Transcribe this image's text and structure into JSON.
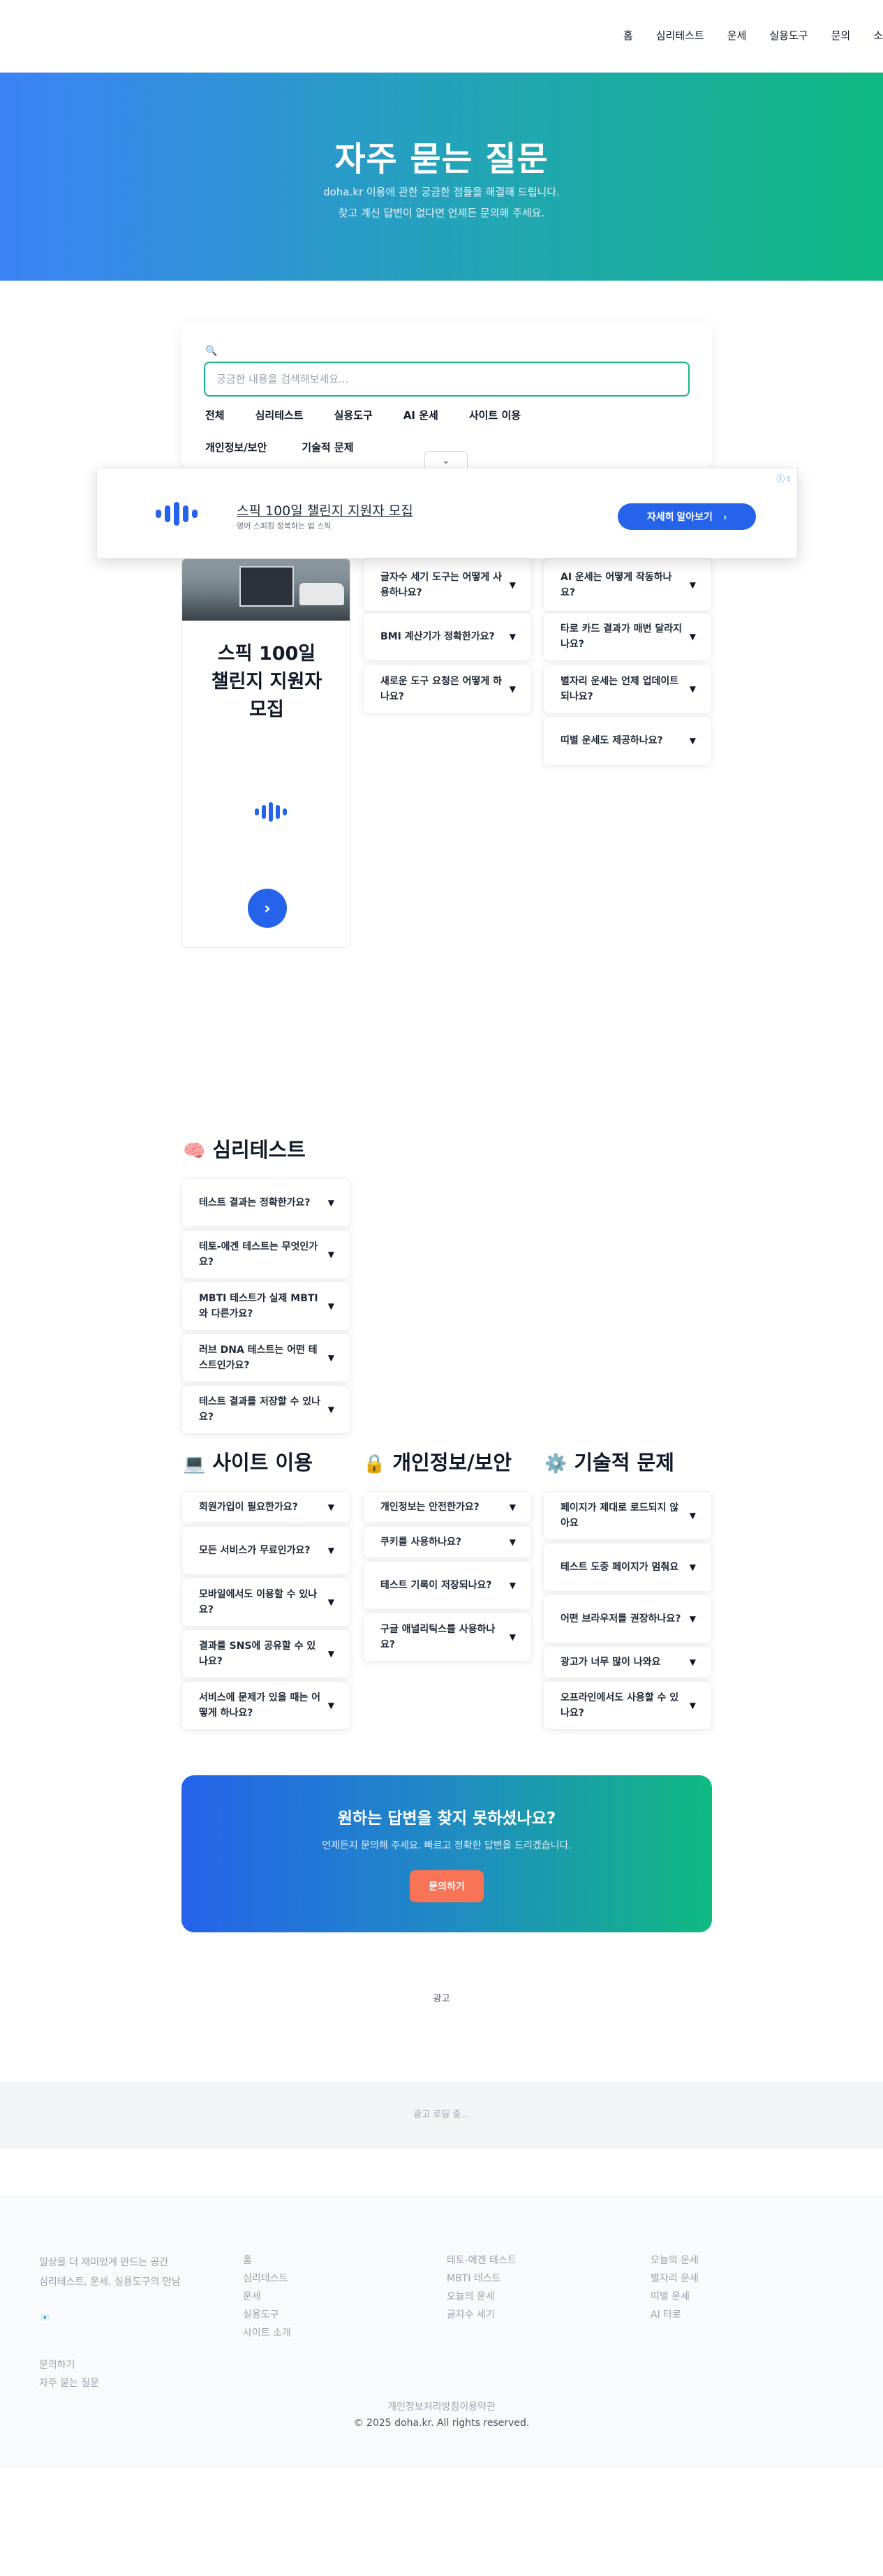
{
  "header": {
    "nav": [
      "홈",
      "심리테스트",
      "운세",
      "실용도구",
      "문의",
      "소"
    ]
  },
  "hero": {
    "title": "자주 묻는 질문",
    "line1": "doha.kr 이용에 관한 궁금한 점들을 해결해 드립니다.",
    "line2": "찾고 계신 답변이 없다면 언제든 문의해 주세요."
  },
  "search": {
    "icon": "🔍",
    "placeholder": "궁금한 내용을 검색해보세요...",
    "categories_row1": [
      "전체",
      "심리테스트",
      "실용도구",
      "AI 운세",
      "사이트 이용"
    ],
    "categories_row2": [
      "개인정보/보안",
      "기술적 문제"
    ],
    "collapse_icon": "⌄"
  },
  "anchor_ad": {
    "title": "스픽 100일 챌린지 지원자 모집",
    "subtitle": "영어 스피킹 정복하는 법 스픽",
    "button": "자세히 알아보기",
    "button_arrow": "›",
    "info_icon": "ⓘ ⁝"
  },
  "side_ad": {
    "title_lines": [
      "스픽 100일",
      "챌린지 지원자",
      "모집"
    ],
    "arrow": "›"
  },
  "faq_col2_top": [
    "글자수 세기 도구는 어떻게 사용하나요?",
    "BMI 계산기가 정확한가요?",
    "새로운 도구 요청은 어떻게 하나요?"
  ],
  "faq_col3_top": [
    "AI 운세는 어떻게 작동하나요?",
    "타로 카드 결과가 매번 달라지나요?",
    "별자리 운세는 언제 업데이트되나요?",
    "띠별 운세도 제공하나요?"
  ],
  "psych": {
    "icon": "🧠",
    "title": "심리테스트",
    "items": [
      "테스트 결과는 정확한가요?",
      "테토-에겐 테스트는 무엇인가요?",
      "MBTI 테스트가 실제 MBTI와 다른가요?",
      "러브 DNA 테스트는 어떤 테스트인가요?",
      "테스트 결과를 저장할 수 있나요?"
    ]
  },
  "site": {
    "icon": "💻",
    "title": "사이트 이용",
    "items": [
      "회원가입이 필요한가요?",
      "모든 서비스가 무료인가요?",
      "모바일에서도 이용할 수 있나요?",
      "결과를 SNS에 공유할 수 있나요?",
      "서비스에 문제가 있을 때는 어떻게 하나요?"
    ]
  },
  "privacy": {
    "icon": "🔒",
    "title": "개인정보/보안",
    "items": [
      "개인정보는 안전한가요?",
      "쿠키를 사용하나요?",
      "테스트 기록이 저장되나요?",
      "구글 애널리틱스를 사용하나요?"
    ]
  },
  "tech": {
    "icon": "⚙️",
    "title": "기술적 문제",
    "items": [
      "페이지가 제대로 로드되지 않아요",
      "테스트 도중 페이지가 멈춰요",
      "어떤 브라우저를 권장하나요?",
      "광고가 너무 많이 나와요",
      "오프라인에서도 사용할 수 있나요?"
    ]
  },
  "arrow": "▼",
  "cta": {
    "title": "원하는 답변을 찾지 못하셨나요?",
    "desc": "언제든지 문의해 주세요. 빠르고 정확한 답변을 드리겠습니다.",
    "button": "문의하기"
  },
  "ads": {
    "label": "광고",
    "loading": "광고 로딩 중..."
  },
  "footer": {
    "desc1": "일상을 더 재미있게 만드는 공간",
    "desc2": "심리테스트, 운세, 실용도구의 만남",
    "social_icon": "📧",
    "links_bottom": [
      "문의하기",
      "자주 묻는 질문"
    ],
    "col2": [
      "홈",
      "심리테스트",
      "운세",
      "실용도구",
      "사이트 소개"
    ],
    "col3": [
      "테토-에겐 테스트",
      "MBTI 테스트",
      "오늘의 운세",
      "글자수 세기"
    ],
    "col4": [
      "오늘의 운세",
      "별자리 운세",
      "띠별 운세",
      "AI 타로"
    ],
    "legal": "개인정보처리방침이용약관",
    "copyright": "© 2025 doha.kr. All rights reserved."
  }
}
